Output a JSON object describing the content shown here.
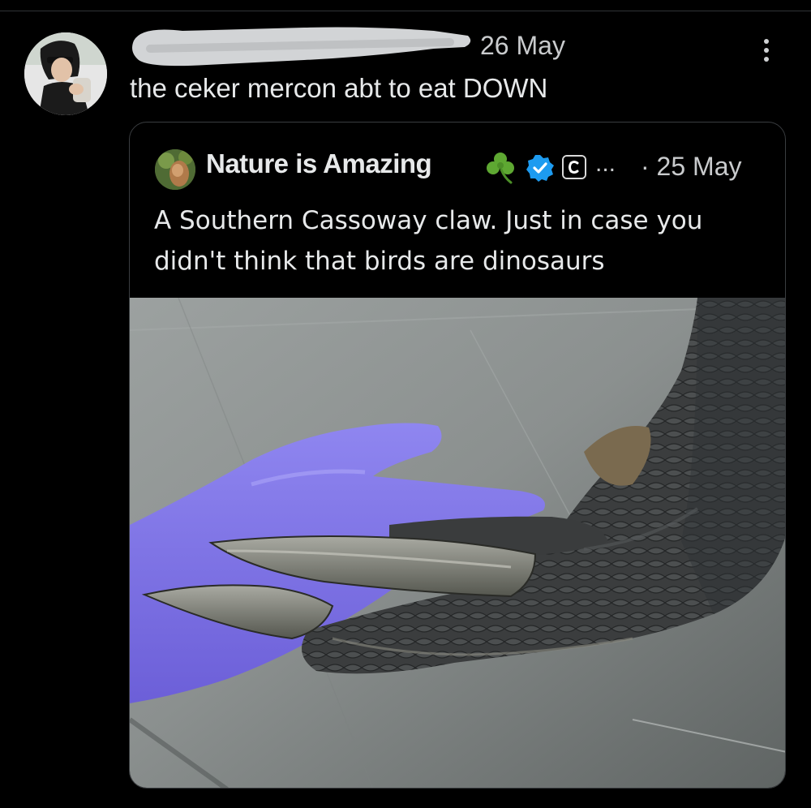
{
  "post": {
    "date": "26 May",
    "text": "the ceker mercon abt to eat DOWN",
    "more_icon": "more-vertical-icon"
  },
  "quoted_post": {
    "author_name": "Nature is Amazing",
    "author_emoji": "☘️",
    "ellipsis": "...",
    "date": "· 25 May",
    "text": "A Southern Cassoway claw. Just in case you didn't think that birds are dinosaurs",
    "badges": [
      "verified-badge-icon",
      "affiliate-badge-icon"
    ]
  },
  "colors": {
    "background": "#000000",
    "text_primary": "#e7e9ea",
    "text_secondary": "#c9cbcd",
    "verified_blue": "#1d9bf0",
    "border": "#3a3d40"
  }
}
